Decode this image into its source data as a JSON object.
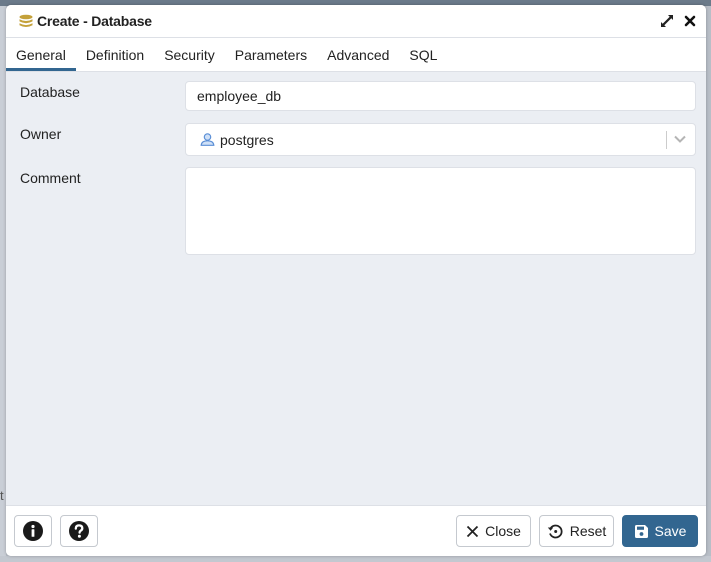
{
  "dialog": {
    "title": "Create - Database",
    "title_icon": "database-icon",
    "maximize_icon": "expand-icon",
    "close_icon": "close-icon"
  },
  "tabs": [
    {
      "label": "General",
      "active": true
    },
    {
      "label": "Definition",
      "active": false
    },
    {
      "label": "Security",
      "active": false
    },
    {
      "label": "Parameters",
      "active": false
    },
    {
      "label": "Advanced",
      "active": false
    },
    {
      "label": "SQL",
      "active": false
    }
  ],
  "form": {
    "database": {
      "label": "Database",
      "value": "employee_db"
    },
    "owner": {
      "label": "Owner",
      "value": "postgres",
      "icon": "user-icon"
    },
    "comment": {
      "label": "Comment",
      "value": ""
    }
  },
  "footer": {
    "info_icon": "info-icon",
    "help_icon": "help-icon",
    "close_label": "Close",
    "reset_label": "Reset",
    "save_label": "Save"
  },
  "backdrop": {
    "stray_text": "t"
  },
  "colors": {
    "accent": "#326690",
    "db_icon": "#c4a13a",
    "user_icon": "#5b8fd6"
  }
}
